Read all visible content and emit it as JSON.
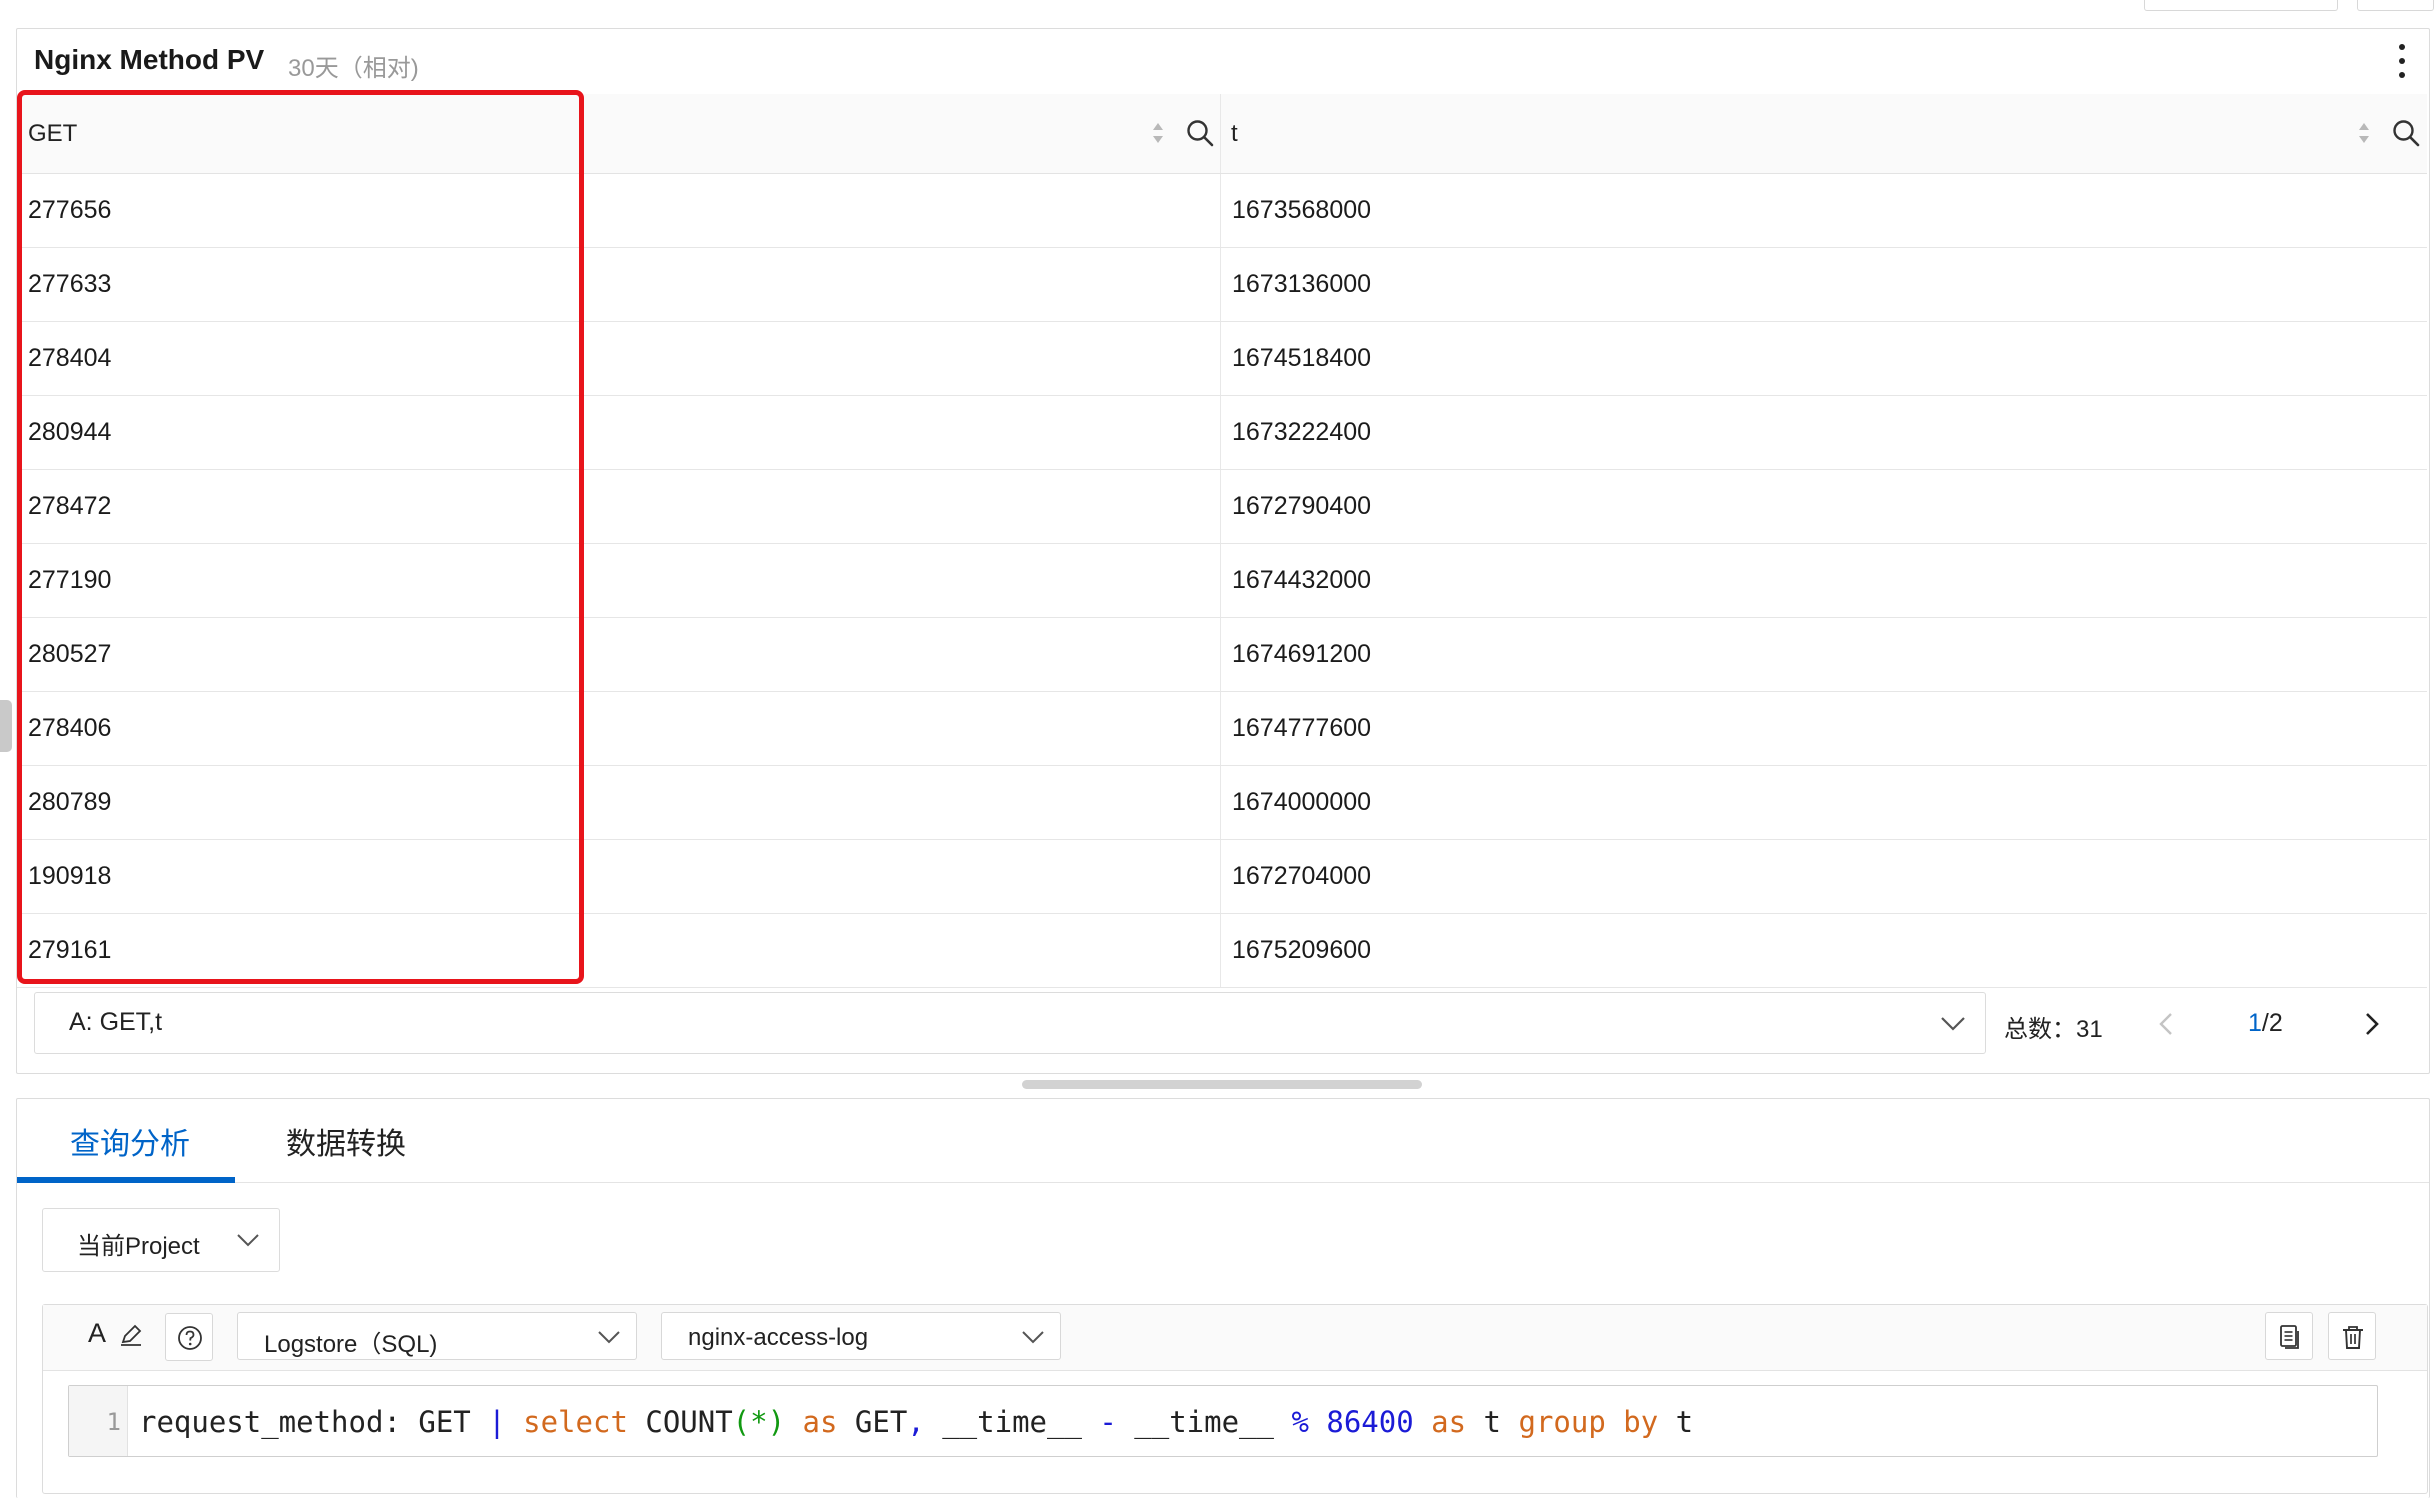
{
  "panel": {
    "title": "Nginx Method PV",
    "time_range": "30天（相对)"
  },
  "table": {
    "columns": [
      "GET",
      "t"
    ],
    "rows": [
      [
        "277656",
        "1673568000"
      ],
      [
        "277633",
        "1673136000"
      ],
      [
        "278404",
        "1674518400"
      ],
      [
        "280944",
        "1673222400"
      ],
      [
        "278472",
        "1672790400"
      ],
      [
        "277190",
        "1674432000"
      ],
      [
        "280527",
        "1674691200"
      ],
      [
        "278406",
        "1674777600"
      ],
      [
        "280789",
        "1674000000"
      ],
      [
        "190918",
        "1672704000"
      ],
      [
        "279161",
        "1675209600"
      ]
    ]
  },
  "footer": {
    "query_select": "A: GET,t",
    "total_label": "总数：31",
    "page_current": "1",
    "page_total": "/2"
  },
  "query": {
    "tabs": [
      "查询分析",
      "数据转换"
    ],
    "active_tab": 0,
    "project_select": "当前Project",
    "query_label_icon": "A",
    "store_type": "Logstore（SQL)",
    "logstore": "nginx-access-log",
    "line_number": "1",
    "code_tokens": [
      {
        "t": "request_method",
        "c": ""
      },
      {
        "t": ": GET ",
        "c": ""
      },
      {
        "t": "|",
        "c": "p"
      },
      {
        "t": " ",
        "c": ""
      },
      {
        "t": "select",
        "c": "k"
      },
      {
        "t": " COUNT",
        "c": ""
      },
      {
        "t": "(*)",
        "c": "g"
      },
      {
        "t": " ",
        "c": ""
      },
      {
        "t": "as",
        "c": "k"
      },
      {
        "t": " GET",
        "c": ""
      },
      {
        "t": ",",
        "c": "p"
      },
      {
        "t": " __time__ ",
        "c": ""
      },
      {
        "t": "-",
        "c": "p"
      },
      {
        "t": " __time__ ",
        "c": ""
      },
      {
        "t": "%",
        "c": "p"
      },
      {
        "t": " ",
        "c": ""
      },
      {
        "t": "86400",
        "c": "n"
      },
      {
        "t": " ",
        "c": ""
      },
      {
        "t": "as",
        "c": "k"
      },
      {
        "t": " t ",
        "c": ""
      },
      {
        "t": "group",
        "c": "k"
      },
      {
        "t": " ",
        "c": ""
      },
      {
        "t": "by",
        "c": "k"
      },
      {
        "t": " t",
        "c": ""
      }
    ]
  },
  "colors": {
    "accent": "#0064c8",
    "highlight": "#e8141b",
    "keyword": "#d2691e",
    "number": "#1b1bd6"
  }
}
